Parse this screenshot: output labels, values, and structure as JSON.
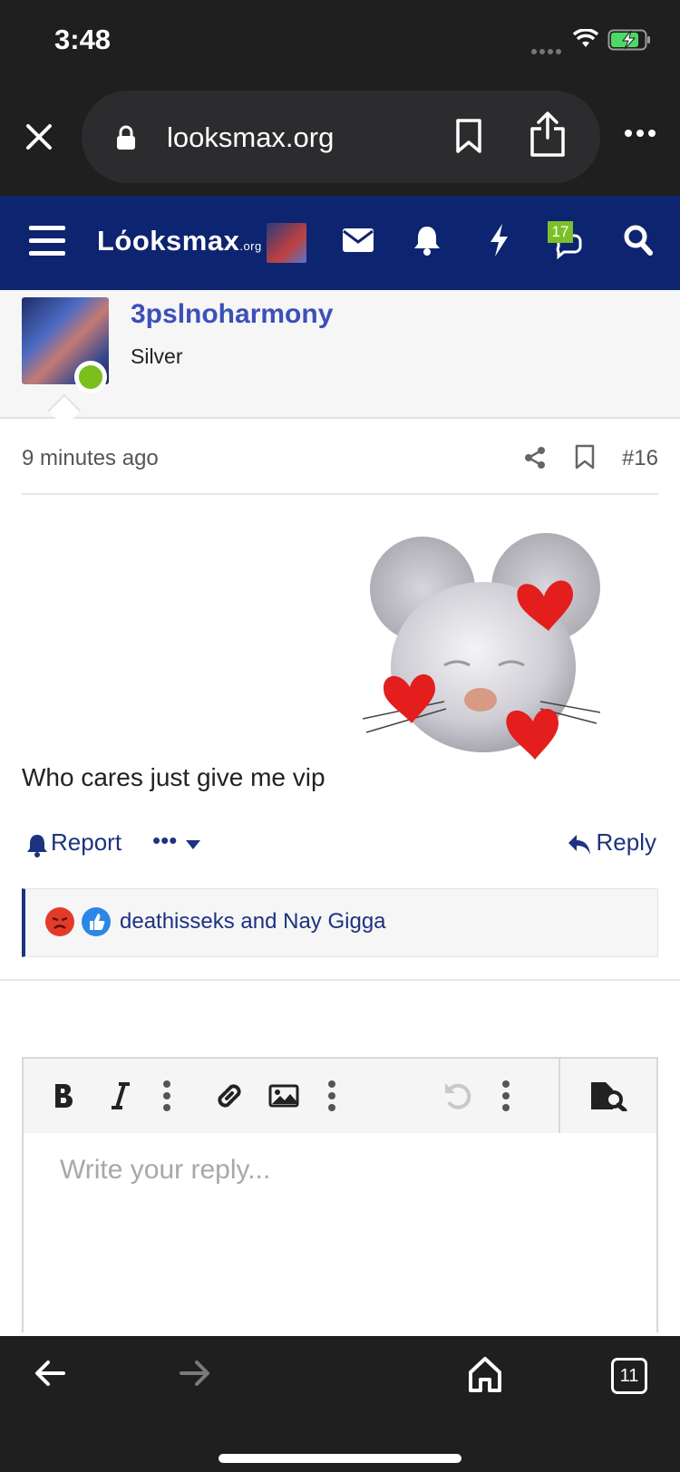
{
  "status_bar": {
    "time": "3:48"
  },
  "browser": {
    "url": "looksmax.org",
    "close_icon": "close-icon",
    "lock_icon": "lock-icon",
    "bookmark_icon": "bookmark-icon",
    "share_icon": "share-icon",
    "more_icon": "more-icon",
    "tab_count": "11"
  },
  "forum_nav": {
    "logo_main": "Lόοksmax",
    "logo_suffix": ".org",
    "chat_badge": "17"
  },
  "post": {
    "username": "3pslnoharmony",
    "user_title": "Silver",
    "time": "9 minutes ago",
    "number": "#16",
    "text": "Who cares just give me vip",
    "report_label": "Report",
    "more_label": "•••",
    "reply_label": "Reply",
    "reactions": {
      "names": "deathisseks and Nay Gigga",
      "types": [
        "angry",
        "like"
      ]
    }
  },
  "editor": {
    "placeholder": "Write your reply..."
  },
  "colors": {
    "nav_bg": "#0d2470",
    "link": "#1d3280",
    "username": "#3c50b8",
    "online": "#7bbf1e",
    "badge": "#7bc028"
  }
}
